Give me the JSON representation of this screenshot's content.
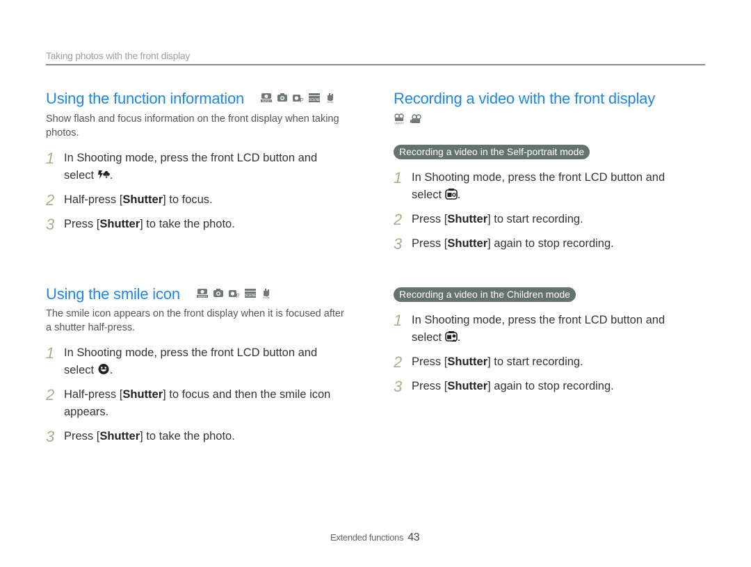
{
  "header": {
    "section_title": "Taking photos with the front display"
  },
  "left": {
    "function_info": {
      "title": "Using the function information",
      "mode_icons": [
        "smart-auto-camera-icon",
        "auto-camera-icon",
        "program-camera-icon",
        "scene-icon",
        "dual-is-icon"
      ],
      "description": "Show flash and focus information on the front display when taking photos.",
      "steps": [
        {
          "num": "1",
          "pre": "In Shooting mode, press the front LCD button and select ",
          "icon": "flash-macro-info-icon",
          "post": "."
        },
        {
          "num": "2",
          "pre": "Half-press [",
          "bold": "Shutter",
          "post": "] to focus."
        },
        {
          "num": "3",
          "pre": "Press [",
          "bold": "Shutter",
          "post": "] to take the photo."
        }
      ]
    },
    "smile_icon": {
      "title": "Using the smile icon",
      "mode_icons": [
        "smart-auto-camera-icon",
        "auto-camera-icon",
        "program-camera-icon",
        "scene-icon",
        "dual-is-icon"
      ],
      "description": "The smile icon appears on the front display when it is focused after a shutter half-press.",
      "steps": [
        {
          "num": "1",
          "pre": "In Shooting mode, press the front LCD button and select ",
          "icon": "smile-face-icon",
          "post": "."
        },
        {
          "num": "2",
          "pre": "Half-press [",
          "bold": "Shutter",
          "post": "] to focus and then the smile icon appears."
        },
        {
          "num": "3",
          "pre": "Press [",
          "bold": "Shutter",
          "post": "] to take the photo."
        }
      ]
    }
  },
  "right": {
    "recording": {
      "title": "Recording a video with the front display",
      "mode_icons": [
        "smart-movie-icon",
        "movie-icon"
      ],
      "self_portrait": {
        "label": "Recording a video in the Self-portrait mode",
        "steps": [
          {
            "num": "1",
            "pre": "In Shooting mode, press the front LCD button and select ",
            "icon": "self-portrait-icon",
            "post": "."
          },
          {
            "num": "2",
            "pre": "Press [",
            "bold": "Shutter",
            "post": "] to start recording."
          },
          {
            "num": "3",
            "pre": "Press [",
            "bold": "Shutter",
            "post": "] again to stop recording."
          }
        ]
      },
      "children": {
        "label": "Recording a video in the Children mode",
        "steps": [
          {
            "num": "1",
            "pre": "In Shooting mode, press the front LCD button and select ",
            "icon": "children-mode-icon",
            "post": "."
          },
          {
            "num": "2",
            "pre": "Press [",
            "bold": "Shutter",
            "post": "] to start recording."
          },
          {
            "num": "3",
            "pre": "Press [",
            "bold": "Shutter",
            "post": "] again to stop recording."
          }
        ]
      }
    }
  },
  "footer": {
    "label": "Extended functions",
    "page_number": "43"
  },
  "colors": {
    "heading": "#1e86e6",
    "step_number": "#a9ae88",
    "pill_bg": "#65736d",
    "rule": "#8a8a8a"
  }
}
